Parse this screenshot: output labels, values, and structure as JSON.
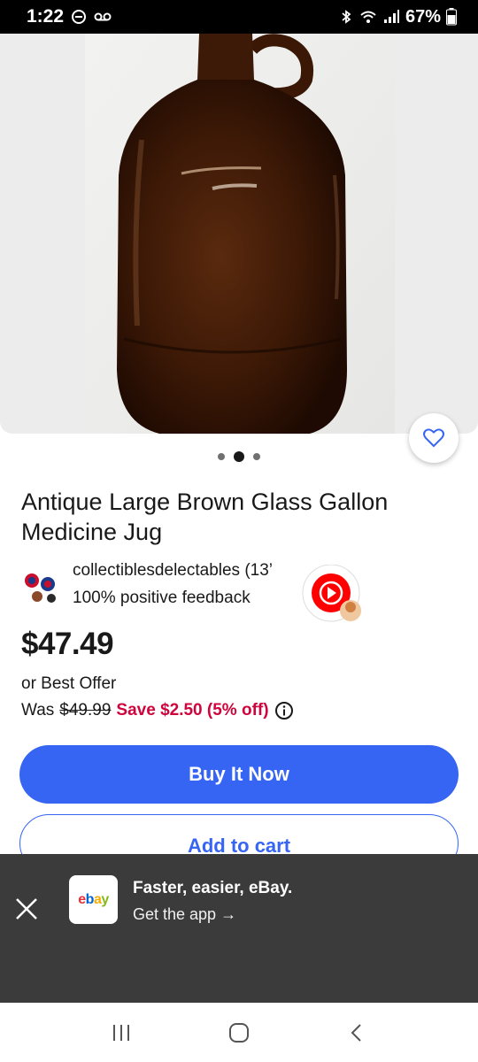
{
  "status_bar": {
    "time": "1:22",
    "battery": "67%"
  },
  "listing": {
    "title": "Antique Large Brown Glass Gallon Medicine Jug",
    "seller_name": "collectiblesdelectables (13’",
    "seller_feedback": "100% positive feedback",
    "price": "$47.49",
    "best_offer": "or Best Offer",
    "was_label": "Was",
    "was_price": "$49.99",
    "save_text": "Save $2.50 (5% off)",
    "image_count": 3,
    "active_image": 2
  },
  "actions": {
    "buy_now": "Buy It Now",
    "add_to_cart": "Add to cart"
  },
  "app_banner": {
    "logo": {
      "e": "e",
      "b": "b",
      "a": "a",
      "y": "y"
    },
    "headline": "Faster, easier, eBay.",
    "cta": "Get the app →"
  },
  "icons": {
    "watch": "heart-icon",
    "info": "info-icon",
    "close": "close-icon",
    "nav_recents": "recents-icon",
    "nav_home": "home-icon",
    "nav_back": "back-icon"
  },
  "colors": {
    "accent": "#3665f3",
    "save": "#d0043c",
    "banner_bg": "#3b3b3b"
  }
}
